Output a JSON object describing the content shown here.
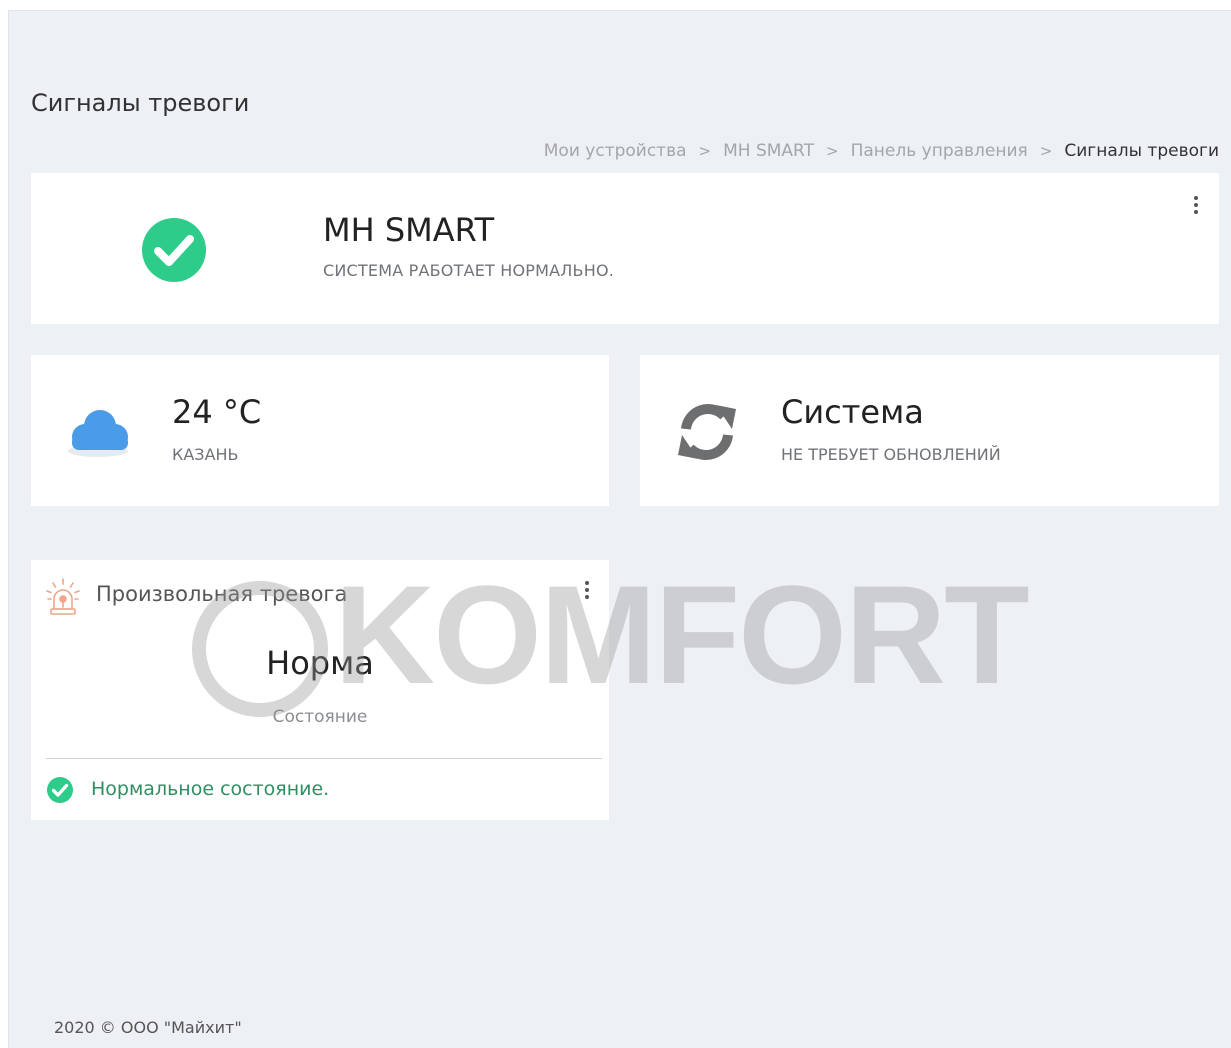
{
  "page": {
    "title": "Сигналы тревоги"
  },
  "breadcrumb": {
    "items": [
      "Мои устройства",
      "MH SMART",
      "Панель управления"
    ],
    "current": "Сигналы тревоги",
    "separator": ">"
  },
  "status_card": {
    "icon": "check-circle-icon",
    "title": "MH SMART",
    "subtitle": "СИСТЕМА РАБОТАЕТ НОРМАЛЬНО.",
    "accent_color": "#2ecc8a"
  },
  "weather_card": {
    "icon": "cloud-icon",
    "temperature": "24 °C",
    "city": "КАЗАНЬ",
    "icon_color": "#4a9be8"
  },
  "update_card": {
    "icon": "refresh-icon",
    "title": "Система",
    "subtitle": "НЕ ТРЕБУЕТ ОБНОВЛЕНИЙ",
    "icon_color": "#6d6e70"
  },
  "alarm_card": {
    "icon": "siren-icon",
    "title": "Произвольная тревога",
    "value": "Норма",
    "caption": "Состояние",
    "footer_icon": "check-circle-icon",
    "footer_text": "Нормальное состояние.",
    "footer_color": "#2f8f62"
  },
  "watermark": {
    "text": "KOMFORT"
  },
  "footer": {
    "copyright": "2020 © ООО \"Майхит\""
  }
}
